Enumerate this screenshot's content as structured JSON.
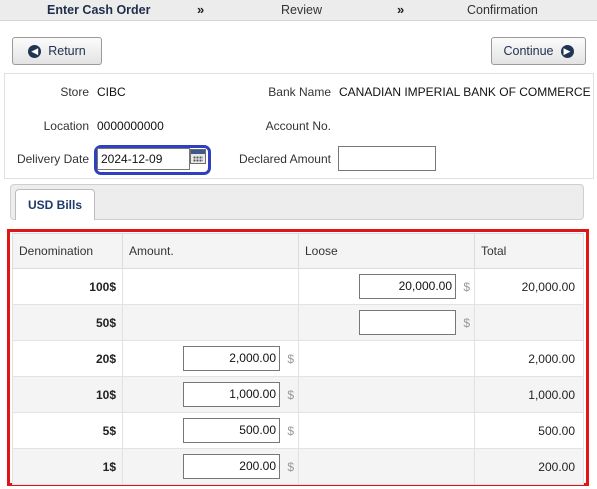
{
  "steps": [
    "Enter Cash Order",
    "Review",
    "Confirmation"
  ],
  "step_separator": "»",
  "buttons": {
    "return_label": "Return",
    "continue_label": "Continue"
  },
  "info": {
    "store_label": "Store",
    "store_value": "CIBC",
    "bank_label": "Bank Name",
    "bank_value": "CANADIAN IMPERIAL BANK OF COMMERCE",
    "location_label": "Location",
    "location_value": "0000000000",
    "account_label": "Account No.",
    "account_value": "",
    "delivery_label": "Delivery Date",
    "delivery_value": "2024-12-09",
    "declared_label": "Declared Amount",
    "declared_value": ""
  },
  "tab": {
    "label": "USD Bills"
  },
  "grid": {
    "headers": [
      "Denomination",
      "Amount.",
      "Loose",
      "Total"
    ],
    "currency_symbol": "$",
    "rows": [
      {
        "den": "100$",
        "amount": null,
        "loose": "20,000.00",
        "total": "20,000.00"
      },
      {
        "den": "50$",
        "amount": null,
        "loose": "",
        "total": ""
      },
      {
        "den": "20$",
        "amount": "2,000.00",
        "loose": null,
        "total": "2,000.00"
      },
      {
        "den": "10$",
        "amount": "1,000.00",
        "loose": null,
        "total": "1,000.00"
      },
      {
        "den": "5$",
        "amount": "500.00",
        "loose": null,
        "total": "500.00"
      },
      {
        "den": "1$",
        "amount": "200.00",
        "loose": null,
        "total": "200.00"
      }
    ]
  },
  "colors": {
    "highlight_red": "#e01616",
    "highlight_blue": "#2f3fbf",
    "accent_navy": "#1f3554"
  }
}
